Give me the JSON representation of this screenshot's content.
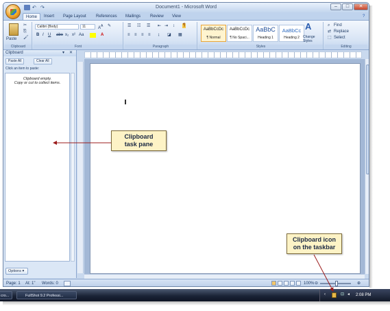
{
  "window": {
    "title": "Document1 - Microsoft Word",
    "controls": [
      "–",
      "□",
      "✕"
    ]
  },
  "tabs": [
    "Home",
    "Insert",
    "Page Layout",
    "References",
    "Mailings",
    "Review",
    "View"
  ],
  "ribbon": {
    "clipboard": {
      "paste_label": "Paste",
      "group_label": "Clipboard"
    },
    "font": {
      "font_name": "Calibri (Body)",
      "font_size": "11",
      "group_label": "Font",
      "row2": [
        "B",
        "I",
        "U",
        "abe",
        "x₂",
        "x²",
        "Aa"
      ]
    },
    "paragraph": {
      "group_label": "Paragraph"
    },
    "styles": {
      "group_label": "Styles",
      "items": [
        {
          "preview": "AaBbCcDc",
          "name": "¶ Normal"
        },
        {
          "preview": "AaBbCcDc",
          "name": "¶ No Spaci..."
        },
        {
          "preview": "AaBbC",
          "name": "Heading 1"
        },
        {
          "preview": "AaBbCc",
          "name": "Heading 2"
        }
      ],
      "change_styles": "Change Styles"
    },
    "editing": {
      "group_label": "Editing",
      "find": "Find",
      "replace": "Replace",
      "select": "Select"
    }
  },
  "taskpane": {
    "title": "Clipboard",
    "paste_all": "Paste All",
    "clear_all": "Clear All",
    "instruction": "Click an item to paste:",
    "empty_line1": "Clipboard empty.",
    "empty_line2": "Copy or cut to collect items.",
    "options": "Options"
  },
  "statusbar": {
    "page": "Page: 1",
    "at": "At: 1\"",
    "words": "Words: 0",
    "zoom": "100%"
  },
  "taskbar": {
    "item1": "cro...",
    "item2": "FullShot 9.2 Professi...",
    "clock": "2:08 PM"
  },
  "callouts": {
    "taskpane": [
      "Clipboard",
      "task pane"
    ],
    "taskbar": [
      "Clipboard icon",
      "on the taskbar"
    ]
  },
  "colors": {
    "callout_bg": "#fdf3c6",
    "arrow": "#9b1c1c"
  }
}
